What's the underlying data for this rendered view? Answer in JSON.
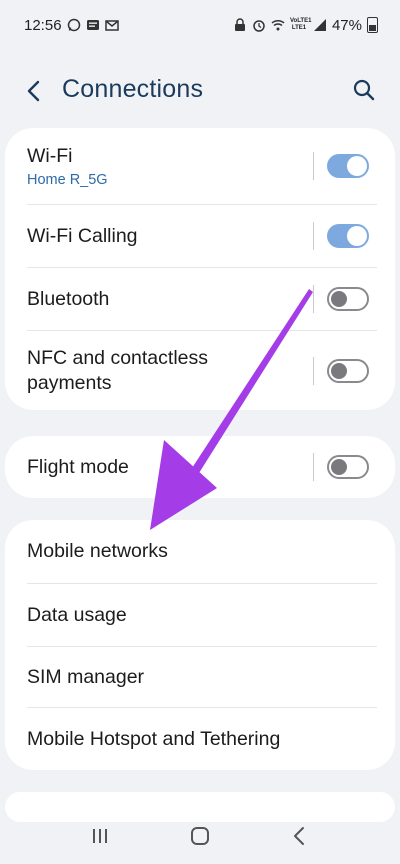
{
  "status_bar": {
    "time": "12:56",
    "battery_percent": "47%",
    "network_label": "VoLTE1 LTE1"
  },
  "header": {
    "title": "Connections"
  },
  "card1": {
    "wifi": {
      "label": "Wi-Fi",
      "sub": "Home R_5G",
      "toggle": "on"
    },
    "wifi_calling": {
      "label": "Wi-Fi Calling",
      "toggle": "on"
    },
    "bluetooth": {
      "label": "Bluetooth",
      "toggle": "off"
    },
    "nfc": {
      "label_line1": "NFC and contactless",
      "label_line2": "payments",
      "toggle": "off"
    }
  },
  "card2": {
    "flight_mode": {
      "label": "Flight mode",
      "toggle": "off"
    }
  },
  "card3": {
    "items": [
      {
        "label": "Mobile networks"
      },
      {
        "label": "Data usage"
      },
      {
        "label": "SIM manager"
      },
      {
        "label": "Mobile Hotspot and Tethering"
      }
    ]
  },
  "colors": {
    "toggle_on": "#7ea9de",
    "subtitle": "#2c6aa8",
    "title": "#1b3b5c",
    "arrow": "#a43de8"
  }
}
